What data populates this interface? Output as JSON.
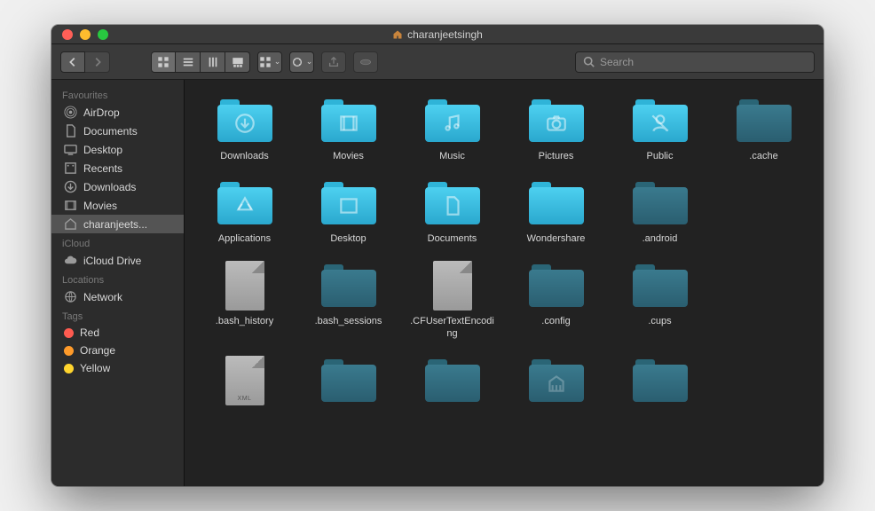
{
  "title": "charanjeetsingh",
  "search": {
    "placeholder": "Search"
  },
  "sidebar": {
    "sections": [
      {
        "header": "Favourites",
        "items": [
          {
            "label": "AirDrop",
            "icon": "airdrop"
          },
          {
            "label": "Documents",
            "icon": "documents"
          },
          {
            "label": "Desktop",
            "icon": "desktop"
          },
          {
            "label": "Recents",
            "icon": "recents"
          },
          {
            "label": "Downloads",
            "icon": "downloads"
          },
          {
            "label": "Movies",
            "icon": "movies"
          },
          {
            "label": "charanjeets...",
            "icon": "home",
            "selected": true
          }
        ]
      },
      {
        "header": "iCloud",
        "items": [
          {
            "label": "iCloud Drive",
            "icon": "icloud"
          }
        ]
      },
      {
        "header": "Locations",
        "items": [
          {
            "label": "Network",
            "icon": "network"
          }
        ]
      },
      {
        "header": "Tags",
        "items": [
          {
            "label": "Red",
            "icon": "tag",
            "color": "#ff5b50"
          },
          {
            "label": "Orange",
            "icon": "tag",
            "color": "#ff9b2a"
          },
          {
            "label": "Yellow",
            "icon": "tag",
            "color": "#ffd52e"
          }
        ]
      }
    ]
  },
  "items": [
    {
      "name": "Downloads",
      "type": "folder",
      "glyph": "download",
      "style": "bright"
    },
    {
      "name": "Movies",
      "type": "folder",
      "glyph": "movie",
      "style": "bright"
    },
    {
      "name": "Music",
      "type": "folder",
      "glyph": "music",
      "style": "bright"
    },
    {
      "name": "Pictures",
      "type": "folder",
      "glyph": "camera",
      "style": "bright"
    },
    {
      "name": "Public",
      "type": "folder",
      "glyph": "public",
      "style": "bright"
    },
    {
      "name": ".cache",
      "type": "folder",
      "glyph": "",
      "style": "dim"
    },
    {
      "name": "Applications",
      "type": "folder",
      "glyph": "app",
      "style": "bright"
    },
    {
      "name": "Desktop",
      "type": "folder",
      "glyph": "desktop",
      "style": "bright"
    },
    {
      "name": "Documents",
      "type": "folder",
      "glyph": "doc",
      "style": "bright"
    },
    {
      "name": "Wondershare",
      "type": "folder",
      "glyph": "",
      "style": "bright"
    },
    {
      "name": ".android",
      "type": "folder",
      "glyph": "",
      "style": "dim"
    },
    {
      "name": "",
      "type": "spacer"
    },
    {
      "name": ".bash_history",
      "type": "file",
      "ext": ""
    },
    {
      "name": ".bash_sessions",
      "type": "folder",
      "glyph": "",
      "style": "dim"
    },
    {
      "name": ".CFUserTextEncoding",
      "type": "file",
      "ext": ""
    },
    {
      "name": ".config",
      "type": "folder",
      "glyph": "",
      "style": "dim"
    },
    {
      "name": ".cups",
      "type": "folder",
      "glyph": "",
      "style": "dim"
    },
    {
      "name": "",
      "type": "spacer"
    },
    {
      "name": "",
      "type": "file",
      "ext": "XML"
    },
    {
      "name": "",
      "type": "folder",
      "glyph": "",
      "style": "dim"
    },
    {
      "name": "",
      "type": "folder",
      "glyph": "",
      "style": "dim"
    },
    {
      "name": "",
      "type": "folder",
      "glyph": "library",
      "style": "dim"
    },
    {
      "name": "",
      "type": "folder",
      "glyph": "",
      "style": "dim"
    },
    {
      "name": "",
      "type": "spacer"
    }
  ]
}
